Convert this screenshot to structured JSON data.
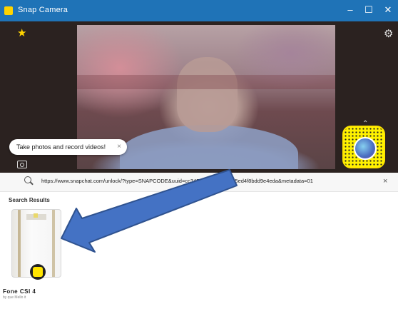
{
  "window": {
    "title": "Snap Camera",
    "minimize": "–",
    "maximize": "☐",
    "close": "✕"
  },
  "camera": {
    "tooltip_text": "Take photos and record videos!",
    "tooltip_close": "×",
    "gear": "⚙",
    "star": "★",
    "chevron": "⌃"
  },
  "search": {
    "url": "https://www.snapchat.com/unlock/?type=SNAPCODE&uuid=cc3459d35eb95483e5ed4f8bdd9e4eda&metadata=01",
    "close": "×"
  },
  "results": {
    "label": "Search Results",
    "items": [
      {
        "name": "Fone CSI 4",
        "author": "by que Mello it"
      }
    ]
  },
  "colors": {
    "titlebar": "#1f73b7",
    "snap_yellow": "#fff200",
    "arrow_fill": "#4472c4",
    "arrow_stroke": "#2f528f"
  }
}
